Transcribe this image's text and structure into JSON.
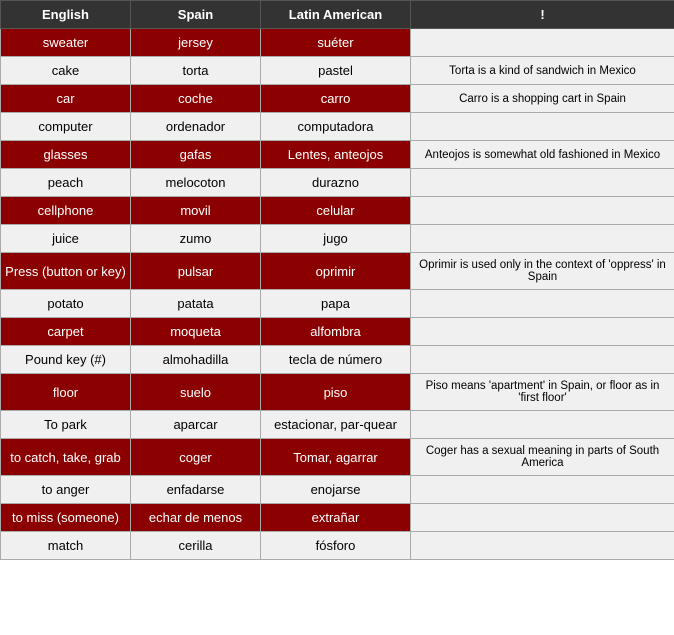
{
  "table": {
    "headers": [
      "English",
      "Spain",
      "Latin American",
      "!"
    ],
    "rows": [
      {
        "english": "sweater",
        "spain": "jersey",
        "latin": "suéter",
        "note": "",
        "dark": true
      },
      {
        "english": "cake",
        "spain": "torta",
        "latin": "pastel",
        "note": "Torta is a kind of sandwich in Mexico",
        "dark": false
      },
      {
        "english": "car",
        "spain": "coche",
        "latin": "carro",
        "note": "Carro is a shopping cart in Spain",
        "dark": true
      },
      {
        "english": "computer",
        "spain": "ordenador",
        "latin": "computadora",
        "note": "",
        "dark": false
      },
      {
        "english": "glasses",
        "spain": "gafas",
        "latin": "Lentes, anteojos",
        "note": "Anteojos is somewhat old fashioned in Mexico",
        "dark": true
      },
      {
        "english": "peach",
        "spain": "melocoton",
        "latin": "durazno",
        "note": "",
        "dark": false
      },
      {
        "english": "cellphone",
        "spain": "movil",
        "latin": "celular",
        "note": "",
        "dark": true
      },
      {
        "english": "juice",
        "spain": "zumo",
        "latin": "jugo",
        "note": "",
        "dark": false
      },
      {
        "english": "Press (button or key)",
        "spain": "pulsar",
        "latin": "oprimir",
        "note": "Oprimir is used only in the context of 'oppress' in Spain",
        "dark": true
      },
      {
        "english": "potato",
        "spain": "patata",
        "latin": "papa",
        "note": "",
        "dark": false
      },
      {
        "english": "carpet",
        "spain": "moqueta",
        "latin": "alfombra",
        "note": "",
        "dark": true
      },
      {
        "english": "Pound key (#)",
        "spain": "almohadilla",
        "latin": "tecla de número",
        "note": "",
        "dark": false
      },
      {
        "english": "floor",
        "spain": "suelo",
        "latin": "piso",
        "note": "Piso means 'apartment' in Spain, or floor as in 'first floor'",
        "dark": true
      },
      {
        "english": "To park",
        "spain": "aparcar",
        "latin": "estacionar, par-quear",
        "note": "",
        "dark": false
      },
      {
        "english": "to catch, take, grab",
        "spain": "coger",
        "latin": "Tomar, agarrar",
        "note": "Coger has a sexual meaning in parts of South America",
        "dark": true
      },
      {
        "english": "to anger",
        "spain": "enfadarse",
        "latin": "enojarse",
        "note": "",
        "dark": false
      },
      {
        "english": "to miss (someone)",
        "spain": "echar de menos",
        "latin": "extrañar",
        "note": "",
        "dark": true
      },
      {
        "english": "match",
        "spain": "cerilla",
        "latin": "fósforo",
        "note": "",
        "dark": false
      }
    ]
  }
}
